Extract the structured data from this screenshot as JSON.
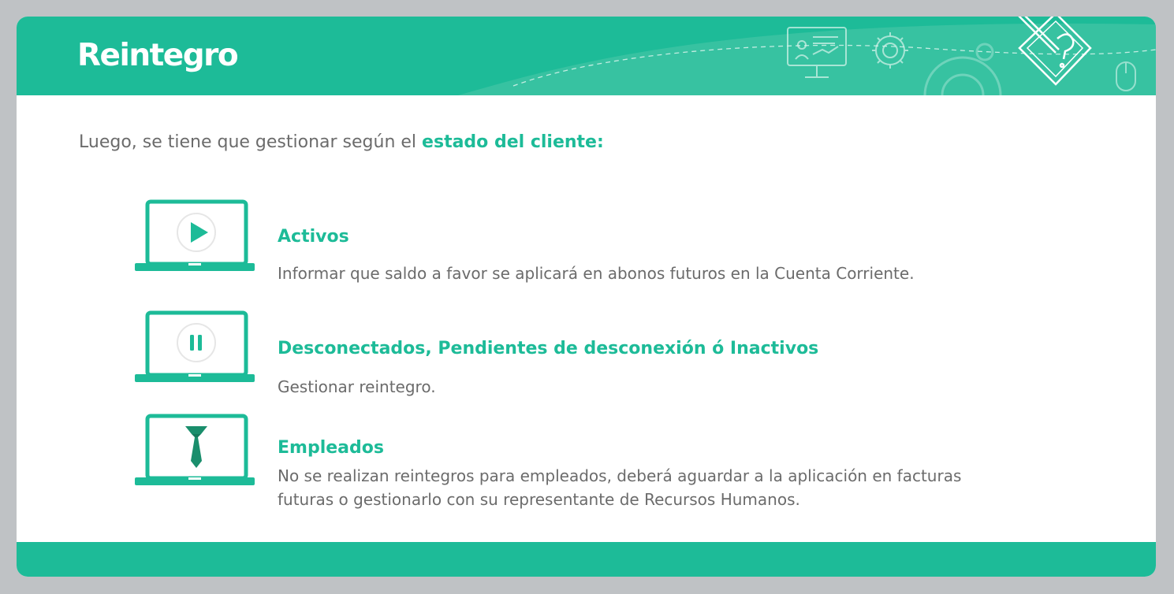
{
  "header": {
    "title": "Reintegro",
    "accent_color": "#1dbb98",
    "decor_icons": [
      "presentation-icon",
      "gear-icon",
      "document-pencil-icon",
      "mouse-icon"
    ]
  },
  "intro": {
    "text": "Luego, se tiene que gestionar según el ",
    "highlight": "estado del cliente:"
  },
  "items": [
    {
      "icon": "laptop-play-icon",
      "title": "Activos",
      "description": "Informar que saldo a favor se aplicará en abonos futuros en la Cuenta Corriente."
    },
    {
      "icon": "laptop-pause-icon",
      "title": "Desconectados, Pendientes de desconexión ó Inactivos",
      "description": "Gestionar reintegro."
    },
    {
      "icon": "laptop-tie-icon",
      "title": "Empleados",
      "description": "No se realizan reintegros para empleados, deberá aguardar a la aplicación en facturas futuras o gestionarlo con su representante de Recursos Humanos."
    }
  ]
}
